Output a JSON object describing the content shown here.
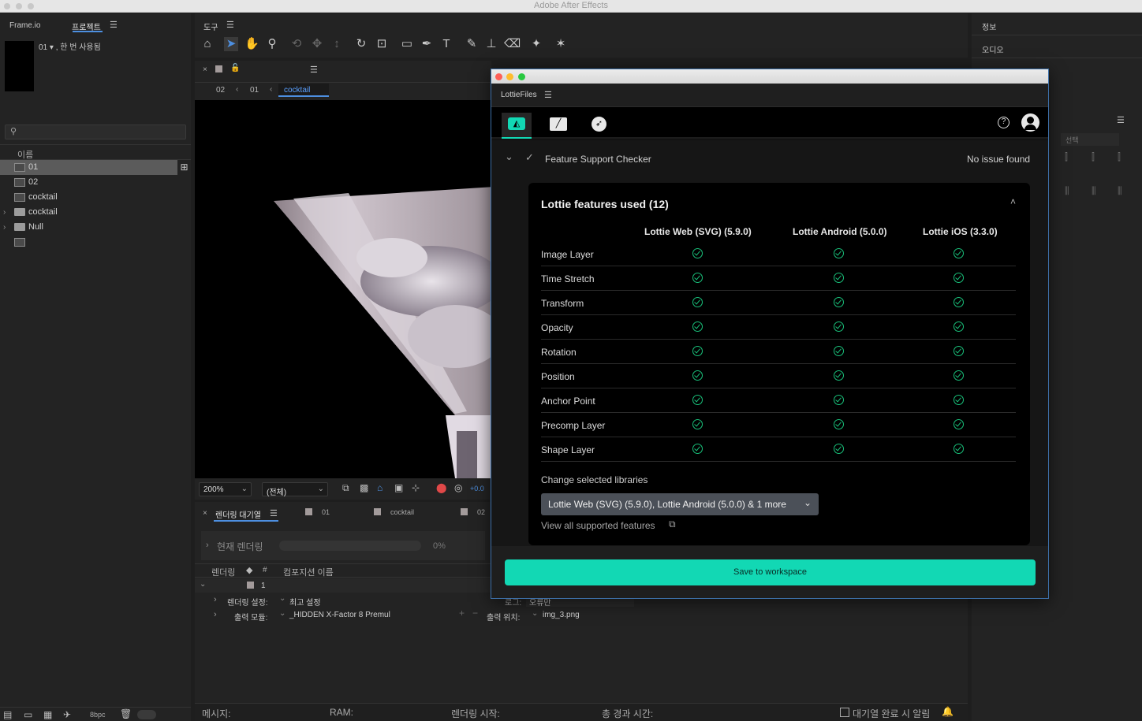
{
  "app": {
    "title": "Adobe After Effects"
  },
  "left_panel": {
    "tab_frameio": "Frame.io",
    "tab_project": "프로젝트",
    "preview_info": "01 ▾ , 한 번 사용됨",
    "column_name": "이름",
    "items": [
      {
        "label": "01",
        "type": "comp"
      },
      {
        "label": "02",
        "type": "comp"
      },
      {
        "label": "cocktail",
        "type": "comp"
      },
      {
        "label": "cocktail",
        "type": "folder"
      },
      {
        "label": "Null",
        "type": "folder"
      },
      {
        "label": "",
        "type": "comp"
      }
    ],
    "bottom_bpc": "8bpc"
  },
  "toolbar": {
    "title": "도구"
  },
  "comp": {
    "breadcrumb": [
      "02",
      "01",
      "cocktail"
    ],
    "zoom": "200%",
    "resolution": "(전체)",
    "exposure": "+0.0"
  },
  "render_queue": {
    "tab_label": "렌더링 대기열",
    "tab_01": "01",
    "tab_cocktail": "cocktail",
    "tab_02": "02",
    "current_render_label": "현재 렌더링",
    "progress_text": "0%",
    "progress": 0,
    "col_render": "렌더링",
    "col_num": "#",
    "col_comp_name": "컴포지션 이름",
    "row_num": "1",
    "render_settings_label": "렌더링 설정:",
    "render_settings_value": "최고 설정",
    "log_label": "로그:",
    "log_value": "오류만",
    "output_module_label": "출력 모듈:",
    "output_module_value": "_HIDDEN X-Factor 8 Premul",
    "output_to_label": "출력 위치:",
    "output_to_value": "img_3.png"
  },
  "status_bar": {
    "message": "메시지:",
    "ram": "RAM:",
    "render_start": "렌더링 시작:",
    "elapsed": "총 경과 시간:",
    "notify": "대기열 완료 시 알림"
  },
  "right_panel": {
    "info": "정보",
    "audio": "오디오",
    "select": "선택"
  },
  "lottie": {
    "panel_title": "LottieFiles",
    "checker_title": "Feature Support Checker",
    "checker_status": "No issue found",
    "features_heading": "Lottie features used (12)",
    "columns": [
      "Lottie Web (SVG) (5.9.0)",
      "Lottie Android (5.0.0)",
      "Lottie iOS (3.3.0)"
    ],
    "features": [
      "Image Layer",
      "Time Stretch",
      "Transform",
      "Opacity",
      "Rotation",
      "Position",
      "Anchor Point",
      "Precomp Layer",
      "Shape Layer"
    ],
    "change_libraries_label": "Change selected libraries",
    "libraries_value": "Lottie Web (SVG) (5.9.0), Lottie Android (5.0.0) & 1 more",
    "view_all_link": "View all supported features",
    "save_button": "Save to workspace",
    "accent": "#12d8b4",
    "check_color": "#19c07a"
  }
}
